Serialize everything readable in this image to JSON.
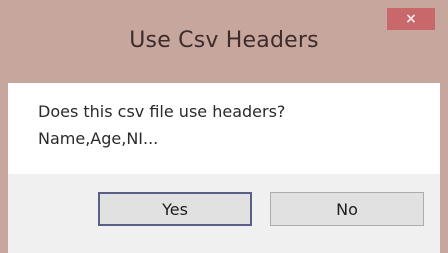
{
  "dialog": {
    "title": "Use Csv Headers",
    "close_label": "×",
    "message": "Does this csv file use headers?\nName,Age,NI...",
    "buttons": {
      "yes_label": "Yes",
      "no_label": "No"
    }
  },
  "colors": {
    "frame": "#c7a69e",
    "close_button": "#c9686a",
    "client_background": "#f0f0f0",
    "message_background": "#ffffff",
    "button_background": "#e1e1e1",
    "default_button_border": "#5a5f8a"
  }
}
